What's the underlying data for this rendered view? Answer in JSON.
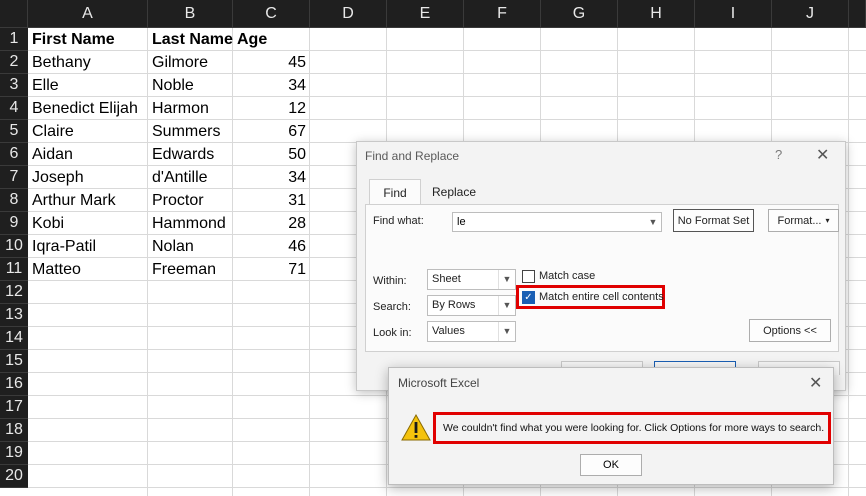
{
  "sheet": {
    "columns": [
      "A",
      "B",
      "C",
      "D",
      "E",
      "F",
      "G",
      "H",
      "I",
      "J"
    ],
    "rows": [
      "1",
      "2",
      "3",
      "4",
      "5",
      "6",
      "7",
      "8",
      "9",
      "10",
      "11",
      "12",
      "13",
      "14",
      "15",
      "16",
      "17",
      "18",
      "19",
      "20"
    ],
    "header": {
      "first": "First Name",
      "last": "Last Name",
      "age": "Age"
    },
    "data": [
      {
        "first": "Bethany",
        "last": "Gilmore",
        "age": "45"
      },
      {
        "first": "Elle",
        "last": "Noble",
        "age": "34"
      },
      {
        "first": "Benedict Elijah",
        "last": "Harmon",
        "age": "12"
      },
      {
        "first": "Claire",
        "last": "Summers",
        "age": "67"
      },
      {
        "first": "Aidan",
        "last": "Edwards",
        "age": "50"
      },
      {
        "first": "Joseph",
        "last": "d'Antille",
        "age": "34"
      },
      {
        "first": "Arthur Mark",
        "last": "Proctor",
        "age": "31"
      },
      {
        "first": "Kobi",
        "last": "Hammond",
        "age": "28"
      },
      {
        "first": "Iqra-Patil",
        "last": "Nolan",
        "age": "46"
      },
      {
        "first": "Matteo",
        "last": "Freeman",
        "age": "71"
      }
    ]
  },
  "find_replace": {
    "title": "Find and Replace",
    "help": "?",
    "close": "✕",
    "tabs": {
      "find": "Find",
      "replace": "Replace"
    },
    "find_what_label": "Find what:",
    "find_what_value": "le",
    "no_format_label": "No Format Set",
    "format_label": "Format...",
    "within_label": "Within:",
    "within_value": "Sheet",
    "search_label": "Search:",
    "search_value": "By Rows",
    "lookin_label": "Look in:",
    "lookin_value": "Values",
    "match_case_label": "Match case",
    "match_case_checked": false,
    "match_entire_label": "Match entire cell contents",
    "match_entire_checked": true,
    "options_label": "Options <<"
  },
  "message_box": {
    "title": "Microsoft Excel",
    "close": "✕",
    "icon": "warning-icon",
    "message": "We couldn't find what you were looking for. Click Options for more ways to search.",
    "ok_label": "OK"
  },
  "colors": {
    "highlight": "#e00000",
    "header_bg": "#1f1f1f",
    "checkbox_on": "#1a5fb4",
    "warning": "#f4c20d"
  }
}
